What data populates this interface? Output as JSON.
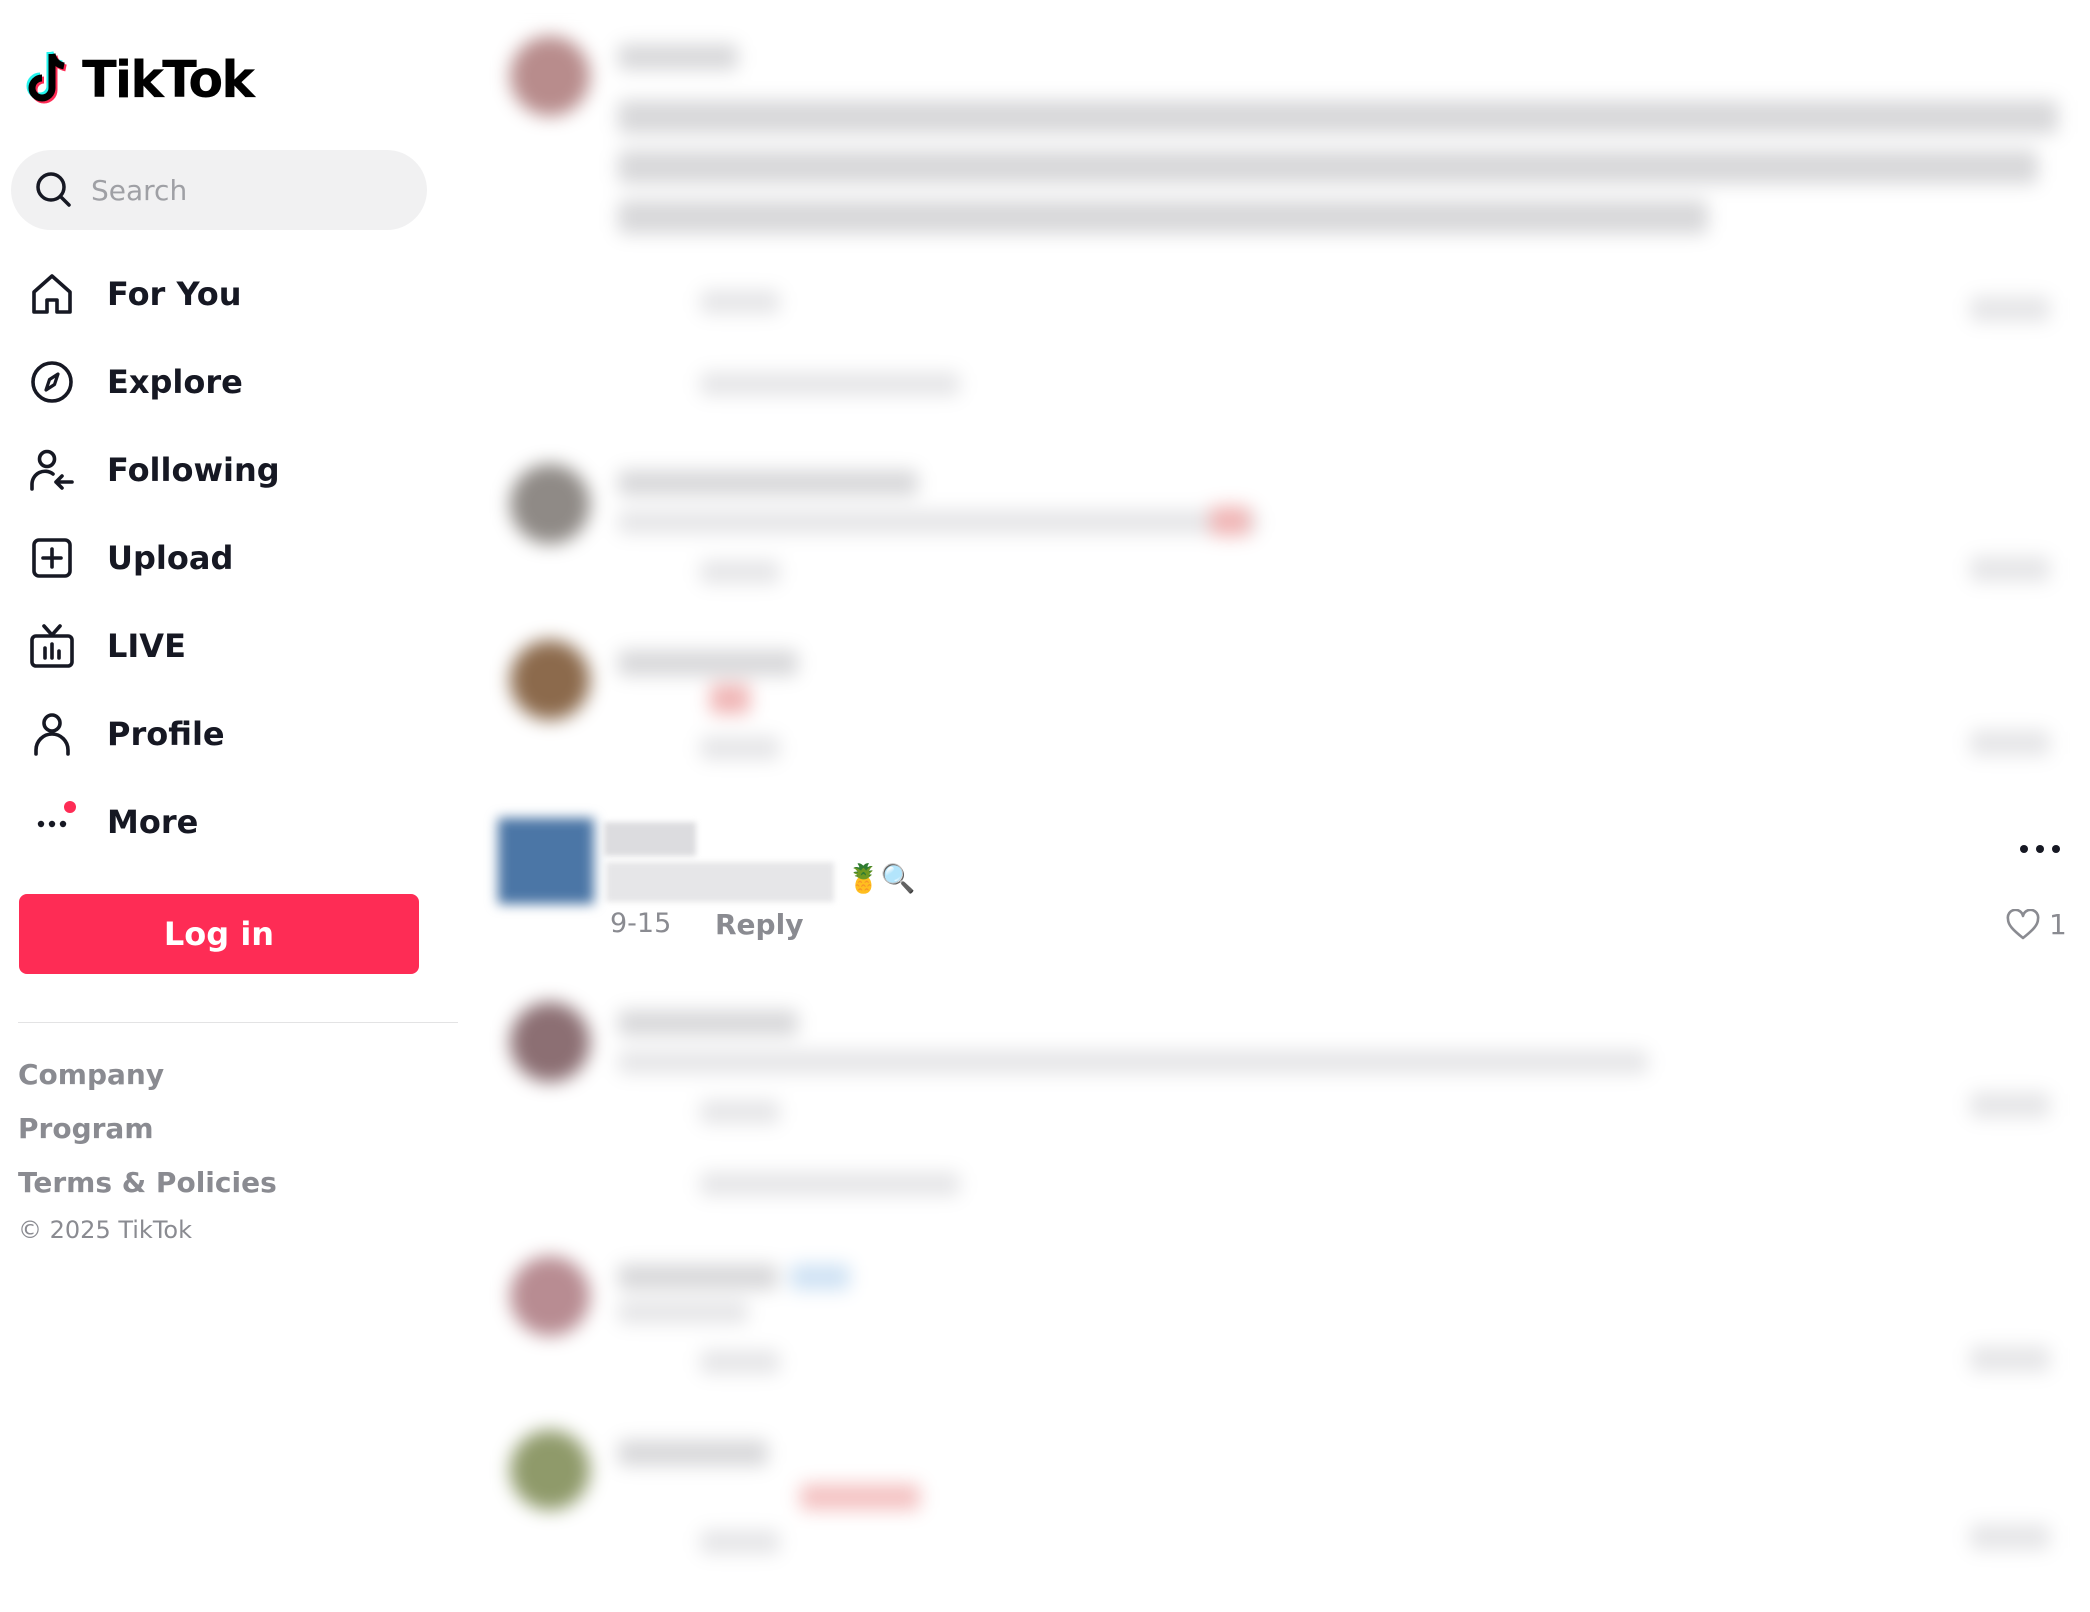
{
  "brand": {
    "name": "TikTok",
    "accent": "#fe2c55",
    "cyan": "#25f4ee"
  },
  "search": {
    "placeholder": "Search"
  },
  "nav": {
    "items": [
      {
        "label": "For You",
        "icon": "home-icon"
      },
      {
        "label": "Explore",
        "icon": "compass-icon"
      },
      {
        "label": "Following",
        "icon": "following-icon"
      },
      {
        "label": "Upload",
        "icon": "upload-icon"
      },
      {
        "label": "LIVE",
        "icon": "live-tv-icon"
      },
      {
        "label": "Profile",
        "icon": "profile-icon"
      },
      {
        "label": "More",
        "icon": "more-dots-icon"
      }
    ]
  },
  "login": {
    "label": "Log in"
  },
  "footer": {
    "links": [
      "Company",
      "Program",
      "Terms & Policies"
    ],
    "copyright": "© 2025 TikTok"
  },
  "comment": {
    "emoji": "🍍🔍",
    "date": "9-15",
    "reply_label": "Reply",
    "likes": "1"
  }
}
